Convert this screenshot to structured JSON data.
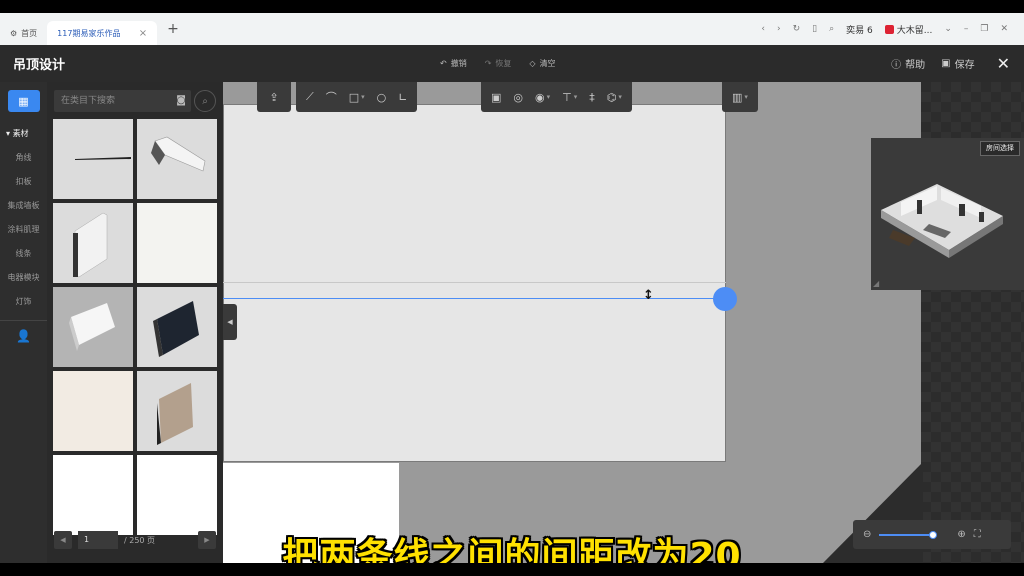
{
  "browser": {
    "tabs": [
      {
        "label": "首页"
      },
      {
        "label": "117期易家乐作品"
      }
    ],
    "right": {
      "label1": "奕易 6",
      "label2": "大木留..."
    }
  },
  "app": {
    "title": "吊顶设计",
    "undo": "撤销",
    "redo": "恢复",
    "clear": "清空",
    "help": "帮助",
    "save": "保存"
  },
  "nav": {
    "head": "素材",
    "items": [
      "角线",
      "扣板",
      "集成墙板",
      "涂料肌理",
      "线条",
      "电器模块",
      "灯饰"
    ]
  },
  "panel": {
    "search_placeholder": "在类目下搜索",
    "page": "1",
    "total_pages": "/ 250 页"
  },
  "preview": {
    "room_select": "房间选择"
  },
  "zoom": {
    "level": 0.95
  },
  "caption": "把两条线之间的间距改为20",
  "colors": {
    "accent": "#4d8df5",
    "caption": "#ffe100"
  }
}
